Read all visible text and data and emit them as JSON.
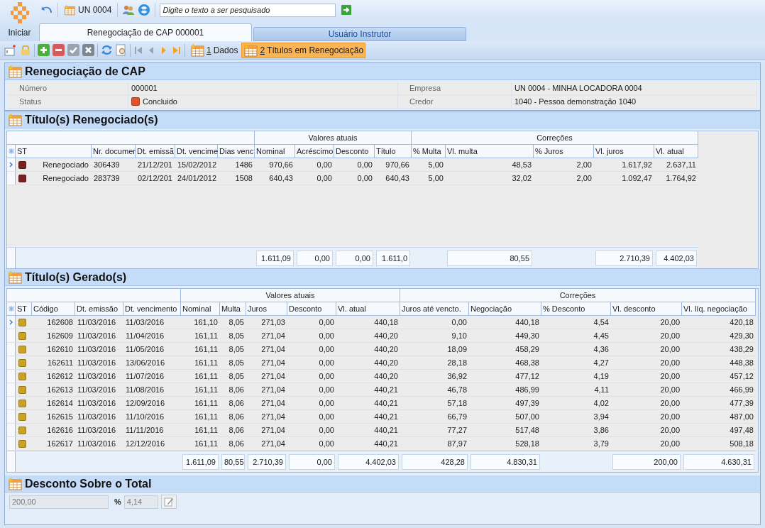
{
  "app": {
    "start_label": "Iniciar",
    "unit": "UN 0004",
    "search": {
      "placeholder": "Digite o texto a ser pesquisado"
    }
  },
  "tabs": [
    {
      "label": "Renegociação de CAP 000001",
      "selected": true
    },
    {
      "label": "Usuário Instrutor",
      "selected": false
    }
  ],
  "views": [
    {
      "hotkey": "1",
      "label": "Dados",
      "selected": false
    },
    {
      "hotkey": "2",
      "label": "Títulos em Renegociação",
      "selected": true
    }
  ],
  "header": {
    "title": "Renegociação de CAP",
    "fields": [
      {
        "label": "Número",
        "value": "000001"
      },
      {
        "label": "Empresa",
        "value": "UN 0004 - MINHA LOCADORA 0004"
      },
      {
        "label": "Status",
        "value": "Concluido",
        "color": "#e8502a"
      },
      {
        "label": "Credor",
        "value": "1040 - Pessoa demonstração 1040"
      }
    ]
  },
  "renegotiated": {
    "title": "Título(s) Renegociado(s)",
    "groups": [
      {
        "columns": [
          {
            "label": "ST"
          },
          {
            "label": "Nr. documer"
          },
          {
            "label": "Dt. emissã"
          },
          {
            "label": "Dt. vencime"
          },
          {
            "label": "Dias venc"
          }
        ]
      },
      {
        "label": "Valores atuais",
        "columns": [
          {
            "label": "Nominal",
            "total": "1.611,09"
          },
          {
            "label": "Acréscimo",
            "total": "0,00"
          },
          {
            "label": "Desconto",
            "total": "0,00"
          },
          {
            "label": "Título",
            "total": "1.611,0"
          }
        ]
      },
      {
        "label": "Correções",
        "columns": [
          {
            "label": "% Multa"
          },
          {
            "label": "Vl. multa",
            "total": "80,55"
          },
          {
            "label": "% Juros"
          },
          {
            "label": "Vl. juros",
            "total": "2.710,39"
          },
          {
            "label": "Vl. atual",
            "total": "4.402,03"
          }
        ]
      }
    ],
    "rows": [
      {
        "selected": true,
        "color": "#7a2020",
        "status": "Renegociado",
        "cells": [
          "306439",
          "21/12/201",
          "15/02/2012",
          "1486",
          "970,66",
          "0,00",
          "0,00",
          "970,66",
          "5,00",
          "48,53",
          "2,00",
          "1.617,92",
          "2.637,11"
        ]
      },
      {
        "selected": false,
        "color": "#7a2020",
        "status": "Renegociado",
        "cells": [
          "283739",
          "02/12/201",
          "24/01/2012",
          "1508",
          "640,43",
          "0,00",
          "0,00",
          "640,43",
          "5,00",
          "32,02",
          "2,00",
          "1.092,47",
          "1.764,92"
        ]
      }
    ]
  },
  "generated": {
    "title": "Título(s) Gerado(s)",
    "groups": [
      {
        "columns": [
          {
            "label": "ST"
          },
          {
            "label": "Código"
          },
          {
            "label": "Dt. emissão"
          },
          {
            "label": "Dt. vencimento"
          }
        ]
      },
      {
        "label": "Valores atuais",
        "columns": [
          {
            "label": "Nominal",
            "total": "1.611,09"
          },
          {
            "label": "Multa",
            "total": "80,55"
          },
          {
            "label": "Juros",
            "total": "2.710,39"
          },
          {
            "label": "Desconto",
            "total": "0,00"
          },
          {
            "label": "Vl. atual",
            "total": "4.402,03"
          }
        ]
      },
      {
        "label": "Correções",
        "columns": [
          {
            "label": "Juros até vencto.",
            "total": "428,28"
          },
          {
            "label": "Negociação",
            "total": "4.830,31"
          },
          {
            "label": "% Desconto"
          },
          {
            "label": "Vl. desconto",
            "total": "200,00"
          },
          {
            "label": "Vl. líq. negociação",
            "total": "4.630,31"
          }
        ]
      }
    ],
    "rows": [
      {
        "selected": true,
        "color": "#c9a227",
        "cells": [
          "162608",
          "11/03/2016",
          "11/03/2016",
          "161,10",
          "8,05",
          "271,03",
          "0,00",
          "440,18",
          "0,00",
          "440,18",
          "4,54",
          "20,00",
          "420,18"
        ]
      },
      {
        "selected": false,
        "color": "#c9a227",
        "cells": [
          "162609",
          "11/03/2016",
          "11/04/2016",
          "161,11",
          "8,05",
          "271,04",
          "0,00",
          "440,20",
          "9,10",
          "449,30",
          "4,45",
          "20,00",
          "429,30"
        ]
      },
      {
        "selected": false,
        "color": "#c9a227",
        "cells": [
          "162610",
          "11/03/2016",
          "11/05/2016",
          "161,11",
          "8,05",
          "271,04",
          "0,00",
          "440,20",
          "18,09",
          "458,29",
          "4,36",
          "20,00",
          "438,29"
        ]
      },
      {
        "selected": false,
        "color": "#c9a227",
        "cells": [
          "162611",
          "11/03/2016",
          "13/06/2016",
          "161,11",
          "8,05",
          "271,04",
          "0,00",
          "440,20",
          "28,18",
          "468,38",
          "4,27",
          "20,00",
          "448,38"
        ]
      },
      {
        "selected": false,
        "color": "#c9a227",
        "cells": [
          "162612",
          "11/03/2016",
          "11/07/2016",
          "161,11",
          "8,05",
          "271,04",
          "0,00",
          "440,20",
          "36,92",
          "477,12",
          "4,19",
          "20,00",
          "457,12"
        ]
      },
      {
        "selected": false,
        "color": "#c9a227",
        "cells": [
          "162613",
          "11/03/2016",
          "11/08/2016",
          "161,11",
          "8,06",
          "271,04",
          "0,00",
          "440,21",
          "46,78",
          "486,99",
          "4,11",
          "20,00",
          "466,99"
        ]
      },
      {
        "selected": false,
        "color": "#c9a227",
        "cells": [
          "162614",
          "11/03/2016",
          "12/09/2016",
          "161,11",
          "8,06",
          "271,04",
          "0,00",
          "440,21",
          "57,18",
          "497,39",
          "4,02",
          "20,00",
          "477,39"
        ]
      },
      {
        "selected": false,
        "color": "#c9a227",
        "cells": [
          "162615",
          "11/03/2016",
          "11/10/2016",
          "161,11",
          "8,06",
          "271,04",
          "0,00",
          "440,21",
          "66,79",
          "507,00",
          "3,94",
          "20,00",
          "487,00"
        ]
      },
      {
        "selected": false,
        "color": "#c9a227",
        "cells": [
          "162616",
          "11/03/2016",
          "11/11/2016",
          "161,11",
          "8,06",
          "271,04",
          "0,00",
          "440,21",
          "77,27",
          "517,48",
          "3,86",
          "20,00",
          "497,48"
        ]
      },
      {
        "selected": false,
        "color": "#c9a227",
        "cells": [
          "162617",
          "11/03/2016",
          "12/12/2016",
          "161,11",
          "8,06",
          "271,04",
          "0,00",
          "440,21",
          "87,97",
          "528,18",
          "3,79",
          "20,00",
          "508,18"
        ]
      }
    ]
  },
  "discount": {
    "title": "Desconto Sobre o Total",
    "value": "200,00",
    "percent_label": "%",
    "percent": "4,14"
  }
}
